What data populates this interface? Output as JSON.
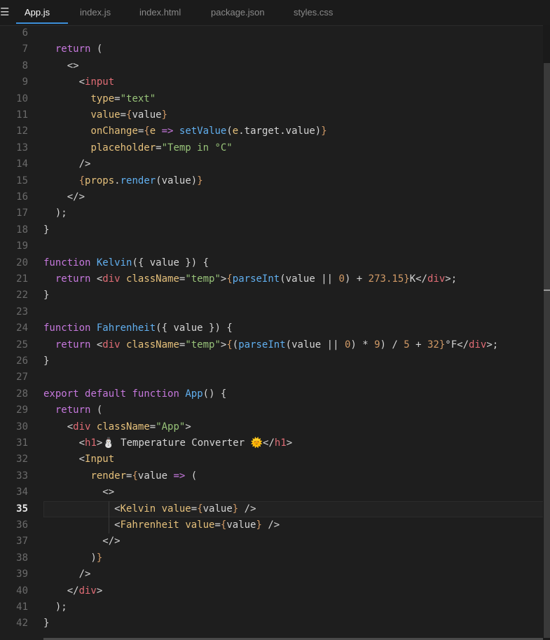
{
  "tabs": [
    {
      "label": "App.js",
      "active": true
    },
    {
      "label": "index.js",
      "active": false
    },
    {
      "label": "index.html",
      "active": false
    },
    {
      "label": "package.json",
      "active": false
    },
    {
      "label": "styles.css",
      "active": false
    }
  ],
  "menu_icon": "hamburger-menu-icon",
  "current_line": 35,
  "theme": {
    "background": "#1e1e1e",
    "keyword": "#c678dd",
    "function": "#61afef",
    "tag": "#e06c75",
    "attribute": "#e5c07b",
    "string": "#98c379",
    "number": "#d19a66",
    "accent": "#3c8ed8"
  },
  "lines": [
    {
      "n": "6",
      "tokens": []
    },
    {
      "n": "7",
      "tokens": [
        [
          "pl",
          "  "
        ],
        [
          "kw",
          "return"
        ],
        [
          "pl",
          " ("
        ]
      ]
    },
    {
      "n": "8",
      "tokens": [
        [
          "pl",
          "    <>"
        ]
      ]
    },
    {
      "n": "9",
      "tokens": [
        [
          "pl",
          "      <"
        ],
        [
          "tag",
          "input"
        ]
      ]
    },
    {
      "n": "10",
      "tokens": [
        [
          "pl",
          "        "
        ],
        [
          "attr",
          "type"
        ],
        [
          "pl",
          "="
        ],
        [
          "str",
          "\"text\""
        ]
      ]
    },
    {
      "n": "11",
      "tokens": [
        [
          "pl",
          "        "
        ],
        [
          "attr",
          "value"
        ],
        [
          "pl",
          "="
        ],
        [
          "br",
          "{"
        ],
        [
          "pl",
          "value"
        ],
        [
          "br",
          "}"
        ]
      ]
    },
    {
      "n": "12",
      "tokens": [
        [
          "pl",
          "        "
        ],
        [
          "attr",
          "onChange"
        ],
        [
          "pl",
          "="
        ],
        [
          "br",
          "{"
        ],
        [
          "attr",
          "e"
        ],
        [
          "pl",
          " "
        ],
        [
          "kw",
          "=>"
        ],
        [
          "pl",
          " "
        ],
        [
          "fn",
          "setValue"
        ],
        [
          "pl",
          "("
        ],
        [
          "attr",
          "e"
        ],
        [
          "pl",
          ".target.value)"
        ],
        [
          "br",
          "}"
        ]
      ]
    },
    {
      "n": "13",
      "tokens": [
        [
          "pl",
          "        "
        ],
        [
          "attr",
          "placeholder"
        ],
        [
          "pl",
          "="
        ],
        [
          "str",
          "\"Temp in °C\""
        ]
      ]
    },
    {
      "n": "14",
      "tokens": [
        [
          "pl",
          "      />"
        ]
      ]
    },
    {
      "n": "15",
      "tokens": [
        [
          "pl",
          "      "
        ],
        [
          "br",
          "{"
        ],
        [
          "attr",
          "props"
        ],
        [
          "pl",
          "."
        ],
        [
          "fn",
          "render"
        ],
        [
          "pl",
          "(value)"
        ],
        [
          "br",
          "}"
        ]
      ]
    },
    {
      "n": "16",
      "tokens": [
        [
          "pl",
          "    </>"
        ]
      ]
    },
    {
      "n": "17",
      "tokens": [
        [
          "pl",
          "  );"
        ]
      ]
    },
    {
      "n": "18",
      "tokens": [
        [
          "pl",
          "}"
        ]
      ]
    },
    {
      "n": "19",
      "tokens": []
    },
    {
      "n": "20",
      "tokens": [
        [
          "kw",
          "function"
        ],
        [
          "pl",
          " "
        ],
        [
          "fn",
          "Kelvin"
        ],
        [
          "pl",
          "({ value }) {"
        ]
      ]
    },
    {
      "n": "21",
      "tokens": [
        [
          "pl",
          "  "
        ],
        [
          "kw",
          "return"
        ],
        [
          "pl",
          " <"
        ],
        [
          "tag",
          "div"
        ],
        [
          "pl",
          " "
        ],
        [
          "attr",
          "className"
        ],
        [
          "pl",
          "="
        ],
        [
          "str",
          "\"temp\""
        ],
        [
          "pl",
          ">"
        ],
        [
          "br",
          "{"
        ],
        [
          "fn",
          "parseInt"
        ],
        [
          "pl",
          "(value || "
        ],
        [
          "num",
          "0"
        ],
        [
          "pl",
          ") + "
        ],
        [
          "num",
          "273.15"
        ],
        [
          "br",
          "}"
        ],
        [
          "pl",
          "K</"
        ],
        [
          "tag",
          "div"
        ],
        [
          "pl",
          ">;"
        ]
      ]
    },
    {
      "n": "22",
      "tokens": [
        [
          "pl",
          "}"
        ]
      ]
    },
    {
      "n": "23",
      "tokens": []
    },
    {
      "n": "24",
      "tokens": [
        [
          "kw",
          "function"
        ],
        [
          "pl",
          " "
        ],
        [
          "fn",
          "Fahrenheit"
        ],
        [
          "pl",
          "({ value }) {"
        ]
      ]
    },
    {
      "n": "25",
      "tokens": [
        [
          "pl",
          "  "
        ],
        [
          "kw",
          "return"
        ],
        [
          "pl",
          " <"
        ],
        [
          "tag",
          "div"
        ],
        [
          "pl",
          " "
        ],
        [
          "attr",
          "className"
        ],
        [
          "pl",
          "="
        ],
        [
          "str",
          "\"temp\""
        ],
        [
          "pl",
          ">"
        ],
        [
          "br",
          "{"
        ],
        [
          "pl",
          "("
        ],
        [
          "fn",
          "parseInt"
        ],
        [
          "pl",
          "(value || "
        ],
        [
          "num",
          "0"
        ],
        [
          "pl",
          ") * "
        ],
        [
          "num",
          "9"
        ],
        [
          "pl",
          ") / "
        ],
        [
          "num",
          "5"
        ],
        [
          "pl",
          " + "
        ],
        [
          "num",
          "32"
        ],
        [
          "br",
          "}"
        ],
        [
          "pl",
          "°F</"
        ],
        [
          "tag",
          "div"
        ],
        [
          "pl",
          ">;"
        ]
      ]
    },
    {
      "n": "26",
      "tokens": [
        [
          "pl",
          "}"
        ]
      ]
    },
    {
      "n": "27",
      "tokens": []
    },
    {
      "n": "28",
      "tokens": [
        [
          "kw",
          "export"
        ],
        [
          "pl",
          " "
        ],
        [
          "kw",
          "default"
        ],
        [
          "pl",
          " "
        ],
        [
          "kw",
          "function"
        ],
        [
          "pl",
          " "
        ],
        [
          "fn",
          "App"
        ],
        [
          "pl",
          "() {"
        ]
      ]
    },
    {
      "n": "29",
      "tokens": [
        [
          "pl",
          "  "
        ],
        [
          "kw",
          "return"
        ],
        [
          "pl",
          " ("
        ]
      ]
    },
    {
      "n": "30",
      "tokens": [
        [
          "pl",
          "    <"
        ],
        [
          "tag",
          "div"
        ],
        [
          "pl",
          " "
        ],
        [
          "attr",
          "className"
        ],
        [
          "pl",
          "="
        ],
        [
          "str",
          "\"App\""
        ],
        [
          "pl",
          ">"
        ]
      ]
    },
    {
      "n": "31",
      "tokens": [
        [
          "pl",
          "      <"
        ],
        [
          "tag",
          "h1"
        ],
        [
          "pl",
          ">⛄ Temperature Converter 🌞</"
        ],
        [
          "tag",
          "h1"
        ],
        [
          "pl",
          ">"
        ]
      ]
    },
    {
      "n": "32",
      "tokens": [
        [
          "pl",
          "      <"
        ],
        [
          "comp",
          "Input"
        ]
      ]
    },
    {
      "n": "33",
      "tokens": [
        [
          "pl",
          "        "
        ],
        [
          "attr",
          "render"
        ],
        [
          "pl",
          "="
        ],
        [
          "br",
          "{"
        ],
        [
          "pl",
          "value "
        ],
        [
          "kw",
          "=>"
        ],
        [
          "pl",
          " ("
        ]
      ]
    },
    {
      "n": "34",
      "tokens": [
        [
          "pl",
          "          <>"
        ]
      ]
    },
    {
      "n": "35",
      "tokens": [
        [
          "pl",
          "            <"
        ],
        [
          "comp",
          "Kelvin"
        ],
        [
          "pl",
          " "
        ],
        [
          "attr",
          "value"
        ],
        [
          "pl",
          "="
        ],
        [
          "br",
          "{"
        ],
        [
          "pl",
          "value"
        ],
        [
          "br",
          "}"
        ],
        [
          "pl",
          " />"
        ]
      ]
    },
    {
      "n": "36",
      "tokens": [
        [
          "pl",
          "            <"
        ],
        [
          "comp",
          "Fahrenheit"
        ],
        [
          "pl",
          " "
        ],
        [
          "attr",
          "value"
        ],
        [
          "pl",
          "="
        ],
        [
          "br",
          "{"
        ],
        [
          "pl",
          "value"
        ],
        [
          "br",
          "}"
        ],
        [
          "pl",
          " />"
        ]
      ]
    },
    {
      "n": "37",
      "tokens": [
        [
          "pl",
          "          </>"
        ]
      ]
    },
    {
      "n": "38",
      "tokens": [
        [
          "pl",
          "        )"
        ],
        [
          "br",
          "}"
        ]
      ]
    },
    {
      "n": "39",
      "tokens": [
        [
          "pl",
          "      />"
        ]
      ]
    },
    {
      "n": "40",
      "tokens": [
        [
          "pl",
          "    </"
        ],
        [
          "tag",
          "div"
        ],
        [
          "pl",
          ">"
        ]
      ]
    },
    {
      "n": "41",
      "tokens": [
        [
          "pl",
          "  );"
        ]
      ]
    },
    {
      "n": "42",
      "tokens": [
        [
          "pl",
          "}"
        ]
      ]
    }
  ]
}
